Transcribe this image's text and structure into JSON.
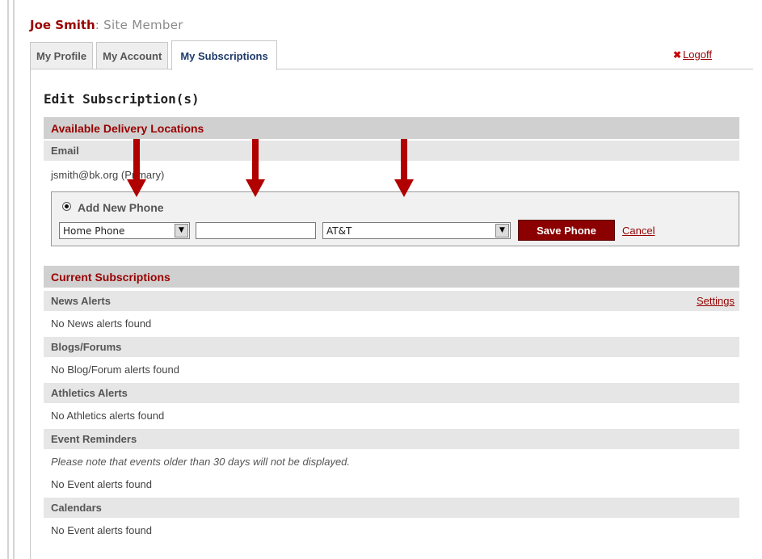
{
  "user": {
    "name": "Joe Smith",
    "role": ": Site Member"
  },
  "tabs": [
    {
      "label": "My Profile"
    },
    {
      "label": "My Account"
    },
    {
      "label": "My Subscriptions"
    }
  ],
  "logoff": {
    "icon": "x-icon",
    "label": "Logoff"
  },
  "page_title": "Edit Subscription(s)",
  "delivery": {
    "header": "Available Delivery Locations",
    "email_label": "Email",
    "email_value": "jsmith@bk.org  (Primary)",
    "add_phone": {
      "label": "Add New Phone",
      "type_value": "Home Phone",
      "number_value": "",
      "carrier_value": "AT&T",
      "save_label": "Save Phone",
      "cancel_label": "Cancel"
    }
  },
  "subscriptions": {
    "header": "Current Subscriptions",
    "news": {
      "label": "News Alerts",
      "settings_label": "Settings",
      "empty": "No News alerts found"
    },
    "blogs": {
      "label": "Blogs/Forums",
      "empty": "No Blog/Forum alerts found"
    },
    "athletics": {
      "label": "Athletics Alerts",
      "empty": "No Athletics alerts found"
    },
    "events": {
      "label": "Event Reminders",
      "note": "Please note that events older than 30 days will not be displayed.",
      "empty": "No Event alerts found"
    },
    "calendars": {
      "label": "Calendars",
      "empty": "No Event alerts found"
    }
  },
  "colors": {
    "brand_red": "#990000",
    "button_red": "#8b0000",
    "arrow_red": "#b00000",
    "header_bar": "#d0d0d0",
    "sub_bar": "#e6e6e6",
    "active_tab_text": "#1e3a6a"
  },
  "icons": [
    "radio-selected-icon",
    "dropdown-arrow-icon",
    "down-arrow-icon",
    "x-icon"
  ]
}
